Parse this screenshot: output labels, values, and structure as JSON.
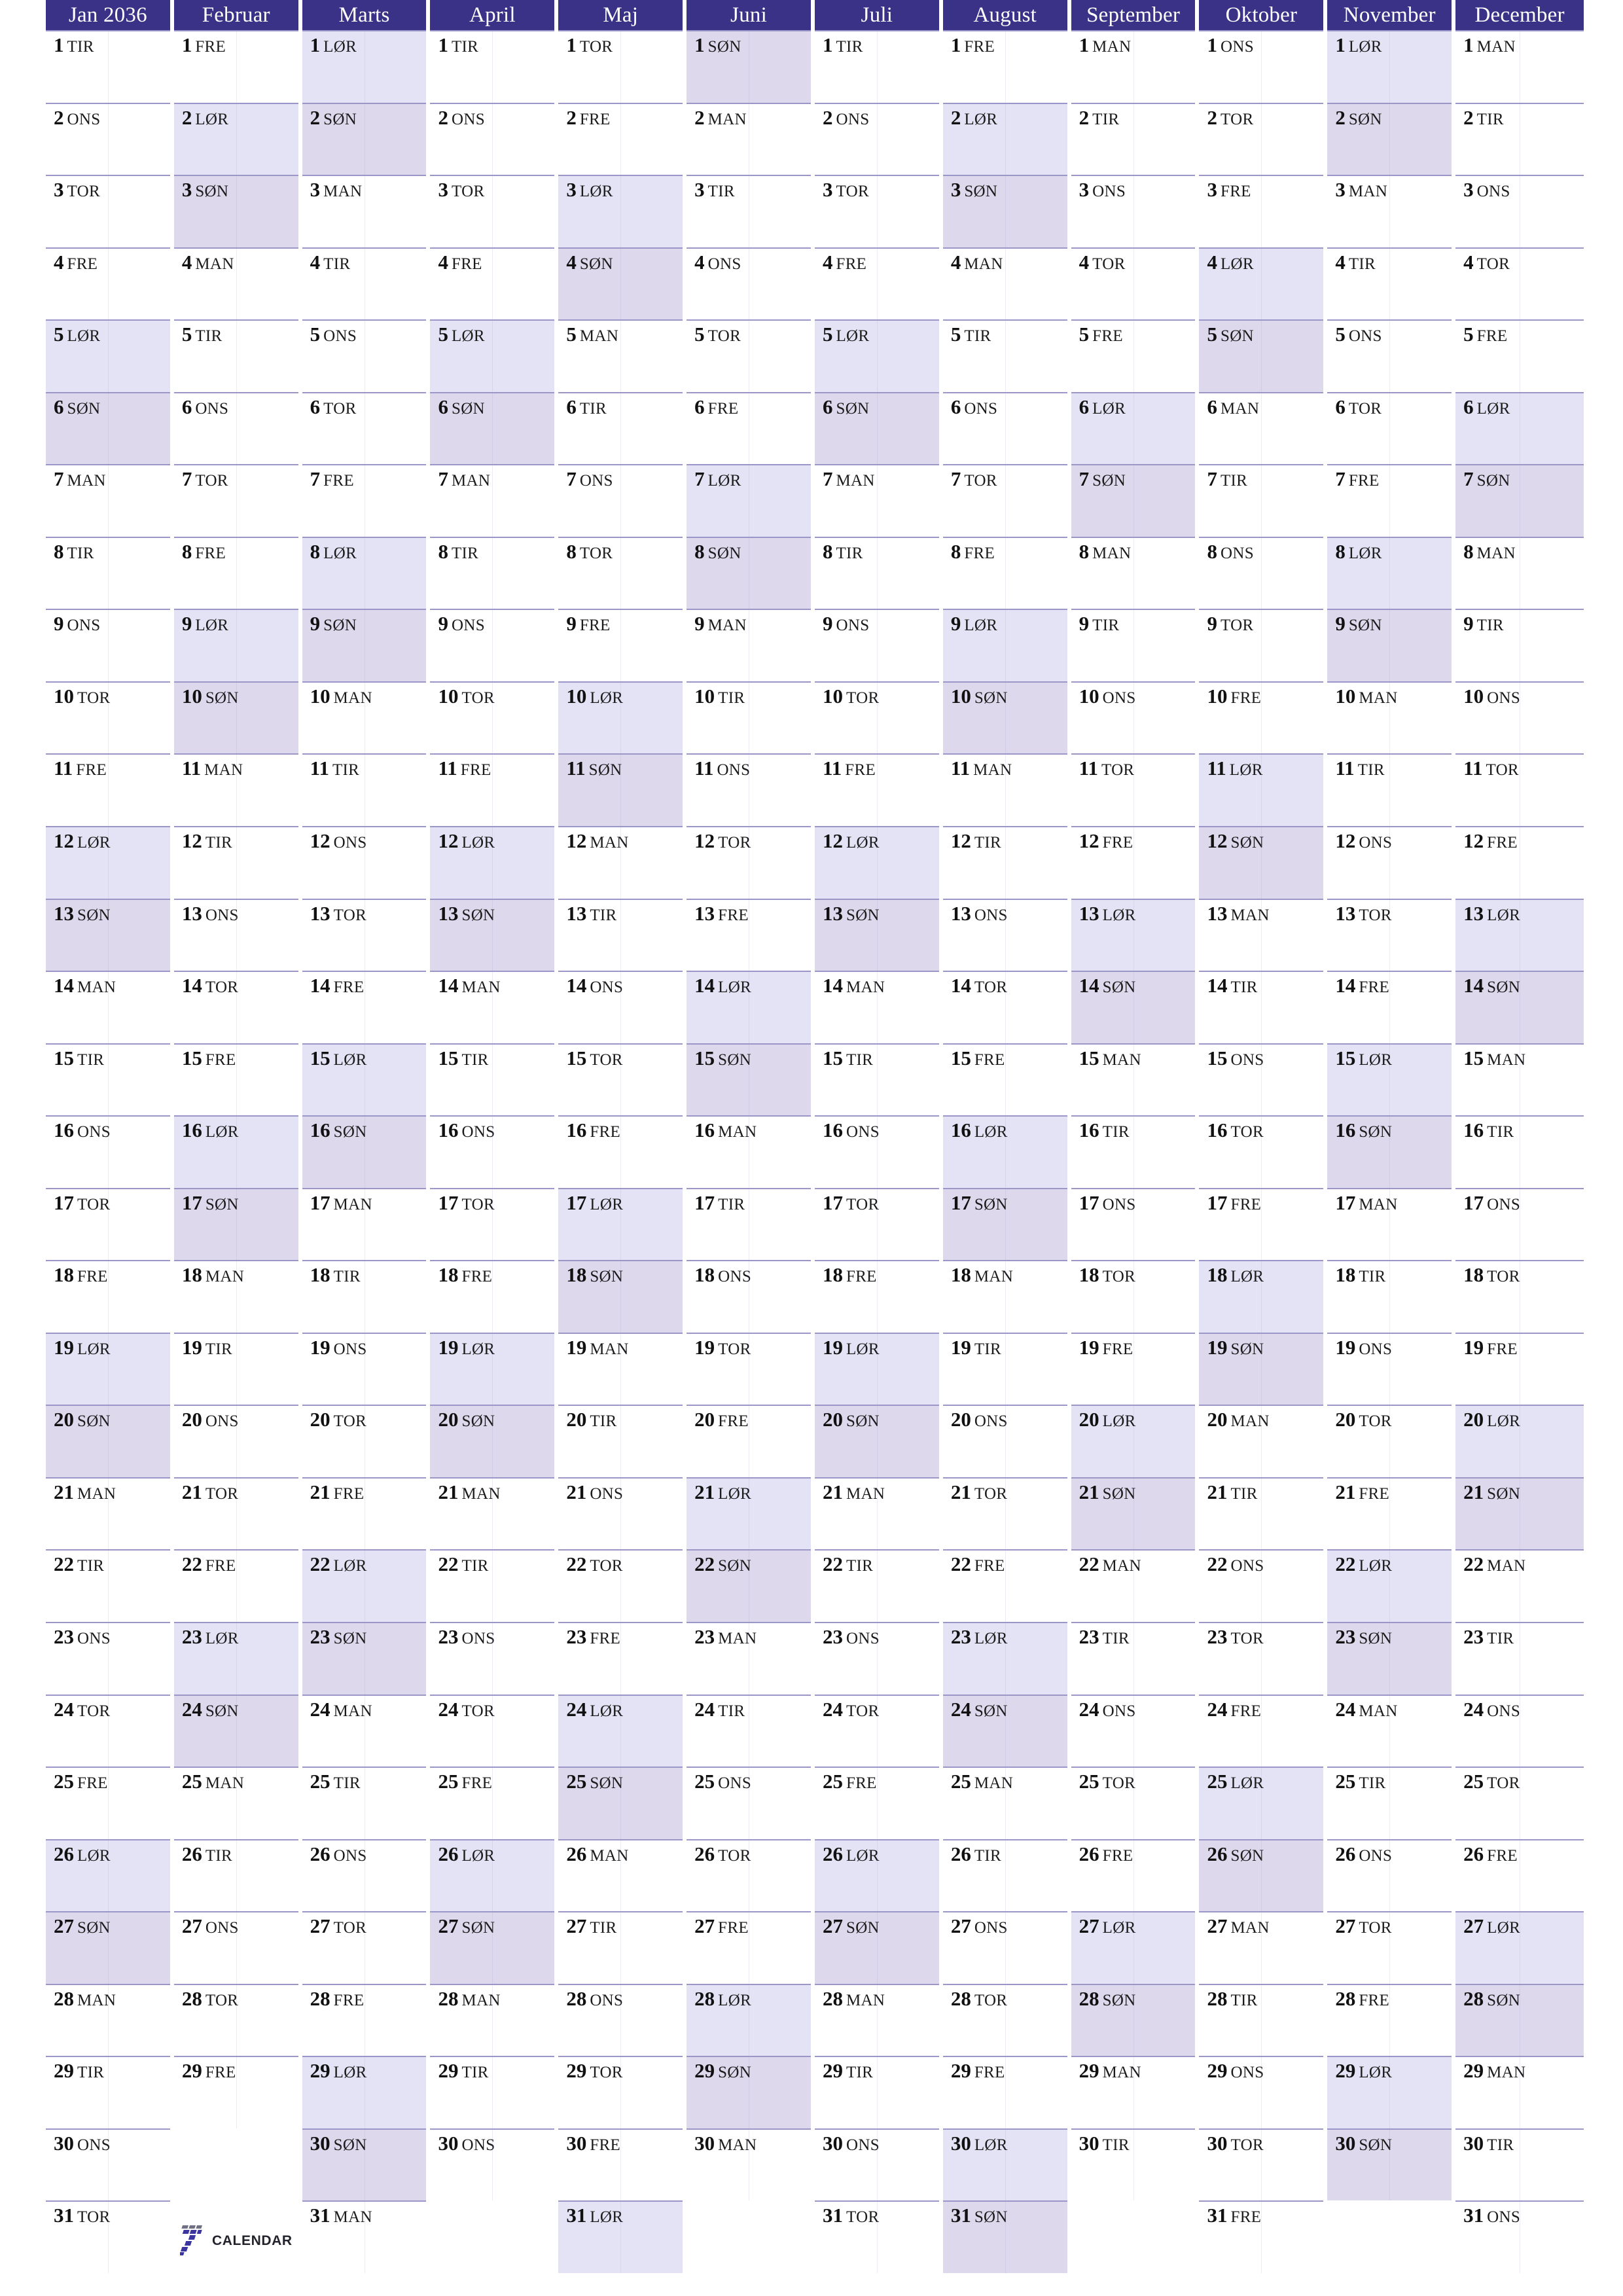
{
  "document": {
    "kind": "yearly-planner-calendar",
    "year": "2036",
    "language": "Danish"
  },
  "colors": {
    "header_background": "#3a3287",
    "header_text": "#ffffff",
    "saturday_fill": "#e3e3f5",
    "sunday_fill": "#ddd8ec",
    "rule_line": "#9a96c8",
    "page_background": "#ffffff",
    "logo_blue": "#3b35a0",
    "logo_gray": "#6f7183",
    "logo_text": "#23232e"
  },
  "logo": {
    "mark": "seven-icon",
    "text": "CALENDAR"
  },
  "weekday_codes": {
    "monday": "MAN",
    "tuesday": "TIR",
    "wednesday": "ONS",
    "thursday": "TOR",
    "friday": "FRE",
    "saturday": "LØR",
    "sunday": "SØN"
  },
  "months": [
    {
      "label": "Jan 2036",
      "days": 31,
      "weekdays": [
        "TIR",
        "ONS",
        "TOR",
        "FRE",
        "LØR",
        "SØN",
        "MAN",
        "TIR",
        "ONS",
        "TOR",
        "FRE",
        "LØR",
        "SØN",
        "MAN",
        "TIR",
        "ONS",
        "TOR",
        "FRE",
        "LØR",
        "SØN",
        "MAN",
        "TIR",
        "ONS",
        "TOR",
        "FRE",
        "LØR",
        "SØN",
        "MAN",
        "TIR",
        "ONS",
        "TOR"
      ]
    },
    {
      "label": "Februar",
      "days": 29,
      "weekdays": [
        "FRE",
        "LØR",
        "SØN",
        "MAN",
        "TIR",
        "ONS",
        "TOR",
        "FRE",
        "LØR",
        "SØN",
        "MAN",
        "TIR",
        "ONS",
        "TOR",
        "FRE",
        "LØR",
        "SØN",
        "MAN",
        "TIR",
        "ONS",
        "TOR",
        "FRE",
        "LØR",
        "SØN",
        "MAN",
        "TIR",
        "ONS",
        "TOR",
        "FRE"
      ]
    },
    {
      "label": "Marts",
      "days": 31,
      "weekdays": [
        "LØR",
        "SØN",
        "MAN",
        "TIR",
        "ONS",
        "TOR",
        "FRE",
        "LØR",
        "SØN",
        "MAN",
        "TIR",
        "ONS",
        "TOR",
        "FRE",
        "LØR",
        "SØN",
        "MAN",
        "TIR",
        "ONS",
        "TOR",
        "FRE",
        "LØR",
        "SØN",
        "MAN",
        "TIR",
        "ONS",
        "TOR",
        "FRE",
        "LØR",
        "SØN",
        "MAN"
      ]
    },
    {
      "label": "April",
      "days": 30,
      "weekdays": [
        "TIR",
        "ONS",
        "TOR",
        "FRE",
        "LØR",
        "SØN",
        "MAN",
        "TIR",
        "ONS",
        "TOR",
        "FRE",
        "LØR",
        "SØN",
        "MAN",
        "TIR",
        "ONS",
        "TOR",
        "FRE",
        "LØR",
        "SØN",
        "MAN",
        "TIR",
        "ONS",
        "TOR",
        "FRE",
        "LØR",
        "SØN",
        "MAN",
        "TIR",
        "ONS"
      ]
    },
    {
      "label": "Maj",
      "days": 31,
      "weekdays": [
        "TOR",
        "FRE",
        "LØR",
        "SØN",
        "MAN",
        "TIR",
        "ONS",
        "TOR",
        "FRE",
        "LØR",
        "SØN",
        "MAN",
        "TIR",
        "ONS",
        "TOR",
        "FRE",
        "LØR",
        "SØN",
        "MAN",
        "TIR",
        "ONS",
        "TOR",
        "FRE",
        "LØR",
        "SØN",
        "MAN",
        "TIR",
        "ONS",
        "TOR",
        "FRE",
        "LØR"
      ]
    },
    {
      "label": "Juni",
      "days": 30,
      "weekdays": [
        "SØN",
        "MAN",
        "TIR",
        "ONS",
        "TOR",
        "FRE",
        "LØR",
        "SØN",
        "MAN",
        "TIR",
        "ONS",
        "TOR",
        "FRE",
        "LØR",
        "SØN",
        "MAN",
        "TIR",
        "ONS",
        "TOR",
        "FRE",
        "LØR",
        "SØN",
        "MAN",
        "TIR",
        "ONS",
        "TOR",
        "FRE",
        "LØR",
        "SØN",
        "MAN"
      ]
    },
    {
      "label": "Juli",
      "days": 31,
      "weekdays": [
        "TIR",
        "ONS",
        "TOR",
        "FRE",
        "LØR",
        "SØN",
        "MAN",
        "TIR",
        "ONS",
        "TOR",
        "FRE",
        "LØR",
        "SØN",
        "MAN",
        "TIR",
        "ONS",
        "TOR",
        "FRE",
        "LØR",
        "SØN",
        "MAN",
        "TIR",
        "ONS",
        "TOR",
        "FRE",
        "LØR",
        "SØN",
        "MAN",
        "TIR",
        "ONS",
        "TOR"
      ]
    },
    {
      "label": "August",
      "days": 31,
      "weekdays": [
        "FRE",
        "LØR",
        "SØN",
        "MAN",
        "TIR",
        "ONS",
        "TOR",
        "FRE",
        "LØR",
        "SØN",
        "MAN",
        "TIR",
        "ONS",
        "TOR",
        "FRE",
        "LØR",
        "SØN",
        "MAN",
        "TIR",
        "ONS",
        "TOR",
        "FRE",
        "LØR",
        "SØN",
        "MAN",
        "TIR",
        "ONS",
        "TOR",
        "FRE",
        "LØR",
        "SØN"
      ]
    },
    {
      "label": "September",
      "days": 30,
      "weekdays": [
        "MAN",
        "TIR",
        "ONS",
        "TOR",
        "FRE",
        "LØR",
        "SØN",
        "MAN",
        "TIR",
        "ONS",
        "TOR",
        "FRE",
        "LØR",
        "SØN",
        "MAN",
        "TIR",
        "ONS",
        "TOR",
        "FRE",
        "LØR",
        "SØN",
        "MAN",
        "TIR",
        "ONS",
        "TOR",
        "FRE",
        "LØR",
        "SØN",
        "MAN",
        "TIR"
      ]
    },
    {
      "label": "Oktober",
      "days": 31,
      "weekdays": [
        "ONS",
        "TOR",
        "FRE",
        "LØR",
        "SØN",
        "MAN",
        "TIR",
        "ONS",
        "TOR",
        "FRE",
        "LØR",
        "SØN",
        "MAN",
        "TIR",
        "ONS",
        "TOR",
        "FRE",
        "LØR",
        "SØN",
        "MAN",
        "TIR",
        "ONS",
        "TOR",
        "FRE",
        "LØR",
        "SØN",
        "MAN",
        "TIR",
        "ONS",
        "TOR",
        "FRE"
      ]
    },
    {
      "label": "November",
      "days": 30,
      "weekdays": [
        "LØR",
        "SØN",
        "MAN",
        "TIR",
        "ONS",
        "TOR",
        "FRE",
        "LØR",
        "SØN",
        "MAN",
        "TIR",
        "ONS",
        "TOR",
        "FRE",
        "LØR",
        "SØN",
        "MAN",
        "TIR",
        "ONS",
        "TOR",
        "FRE",
        "LØR",
        "SØN",
        "MAN",
        "TIR",
        "ONS",
        "TOR",
        "FRE",
        "LØR",
        "SØN"
      ]
    },
    {
      "label": "December",
      "days": 31,
      "weekdays": [
        "MAN",
        "TIR",
        "ONS",
        "TOR",
        "FRE",
        "LØR",
        "SØN",
        "MAN",
        "TIR",
        "ONS",
        "TOR",
        "FRE",
        "LØR",
        "SØN",
        "MAN",
        "TIR",
        "ONS",
        "TOR",
        "FRE",
        "LØR",
        "SØN",
        "MAN",
        "TIR",
        "ONS",
        "TOR",
        "FRE",
        "LØR",
        "SØN",
        "MAN",
        "TIR",
        "ONS"
      ]
    }
  ]
}
